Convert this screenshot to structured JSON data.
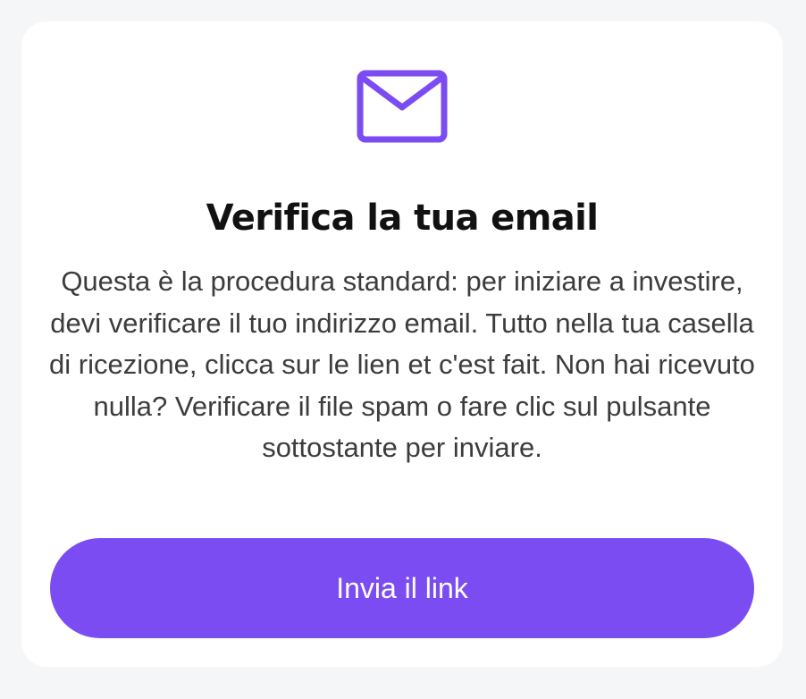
{
  "card": {
    "icon": "envelope-icon",
    "title": "Verifica la tua email",
    "body": "Questa è la procedura standard: per iniziare a investire, devi verificare il tuo indirizzo email. Tutto nella tua casella di ricezione, clicca sur le lien et c'est fait. Non hai ricevuto nulla? Verificare il file spam o fare clic sul pulsante sottostante per inviare.",
    "button_label": "Invia il link"
  },
  "colors": {
    "page_background": "#f5f6f8",
    "card_background": "#ffffff",
    "accent": "#7b4cf2",
    "title_text": "#111111",
    "body_text": "#3c3c3c"
  }
}
